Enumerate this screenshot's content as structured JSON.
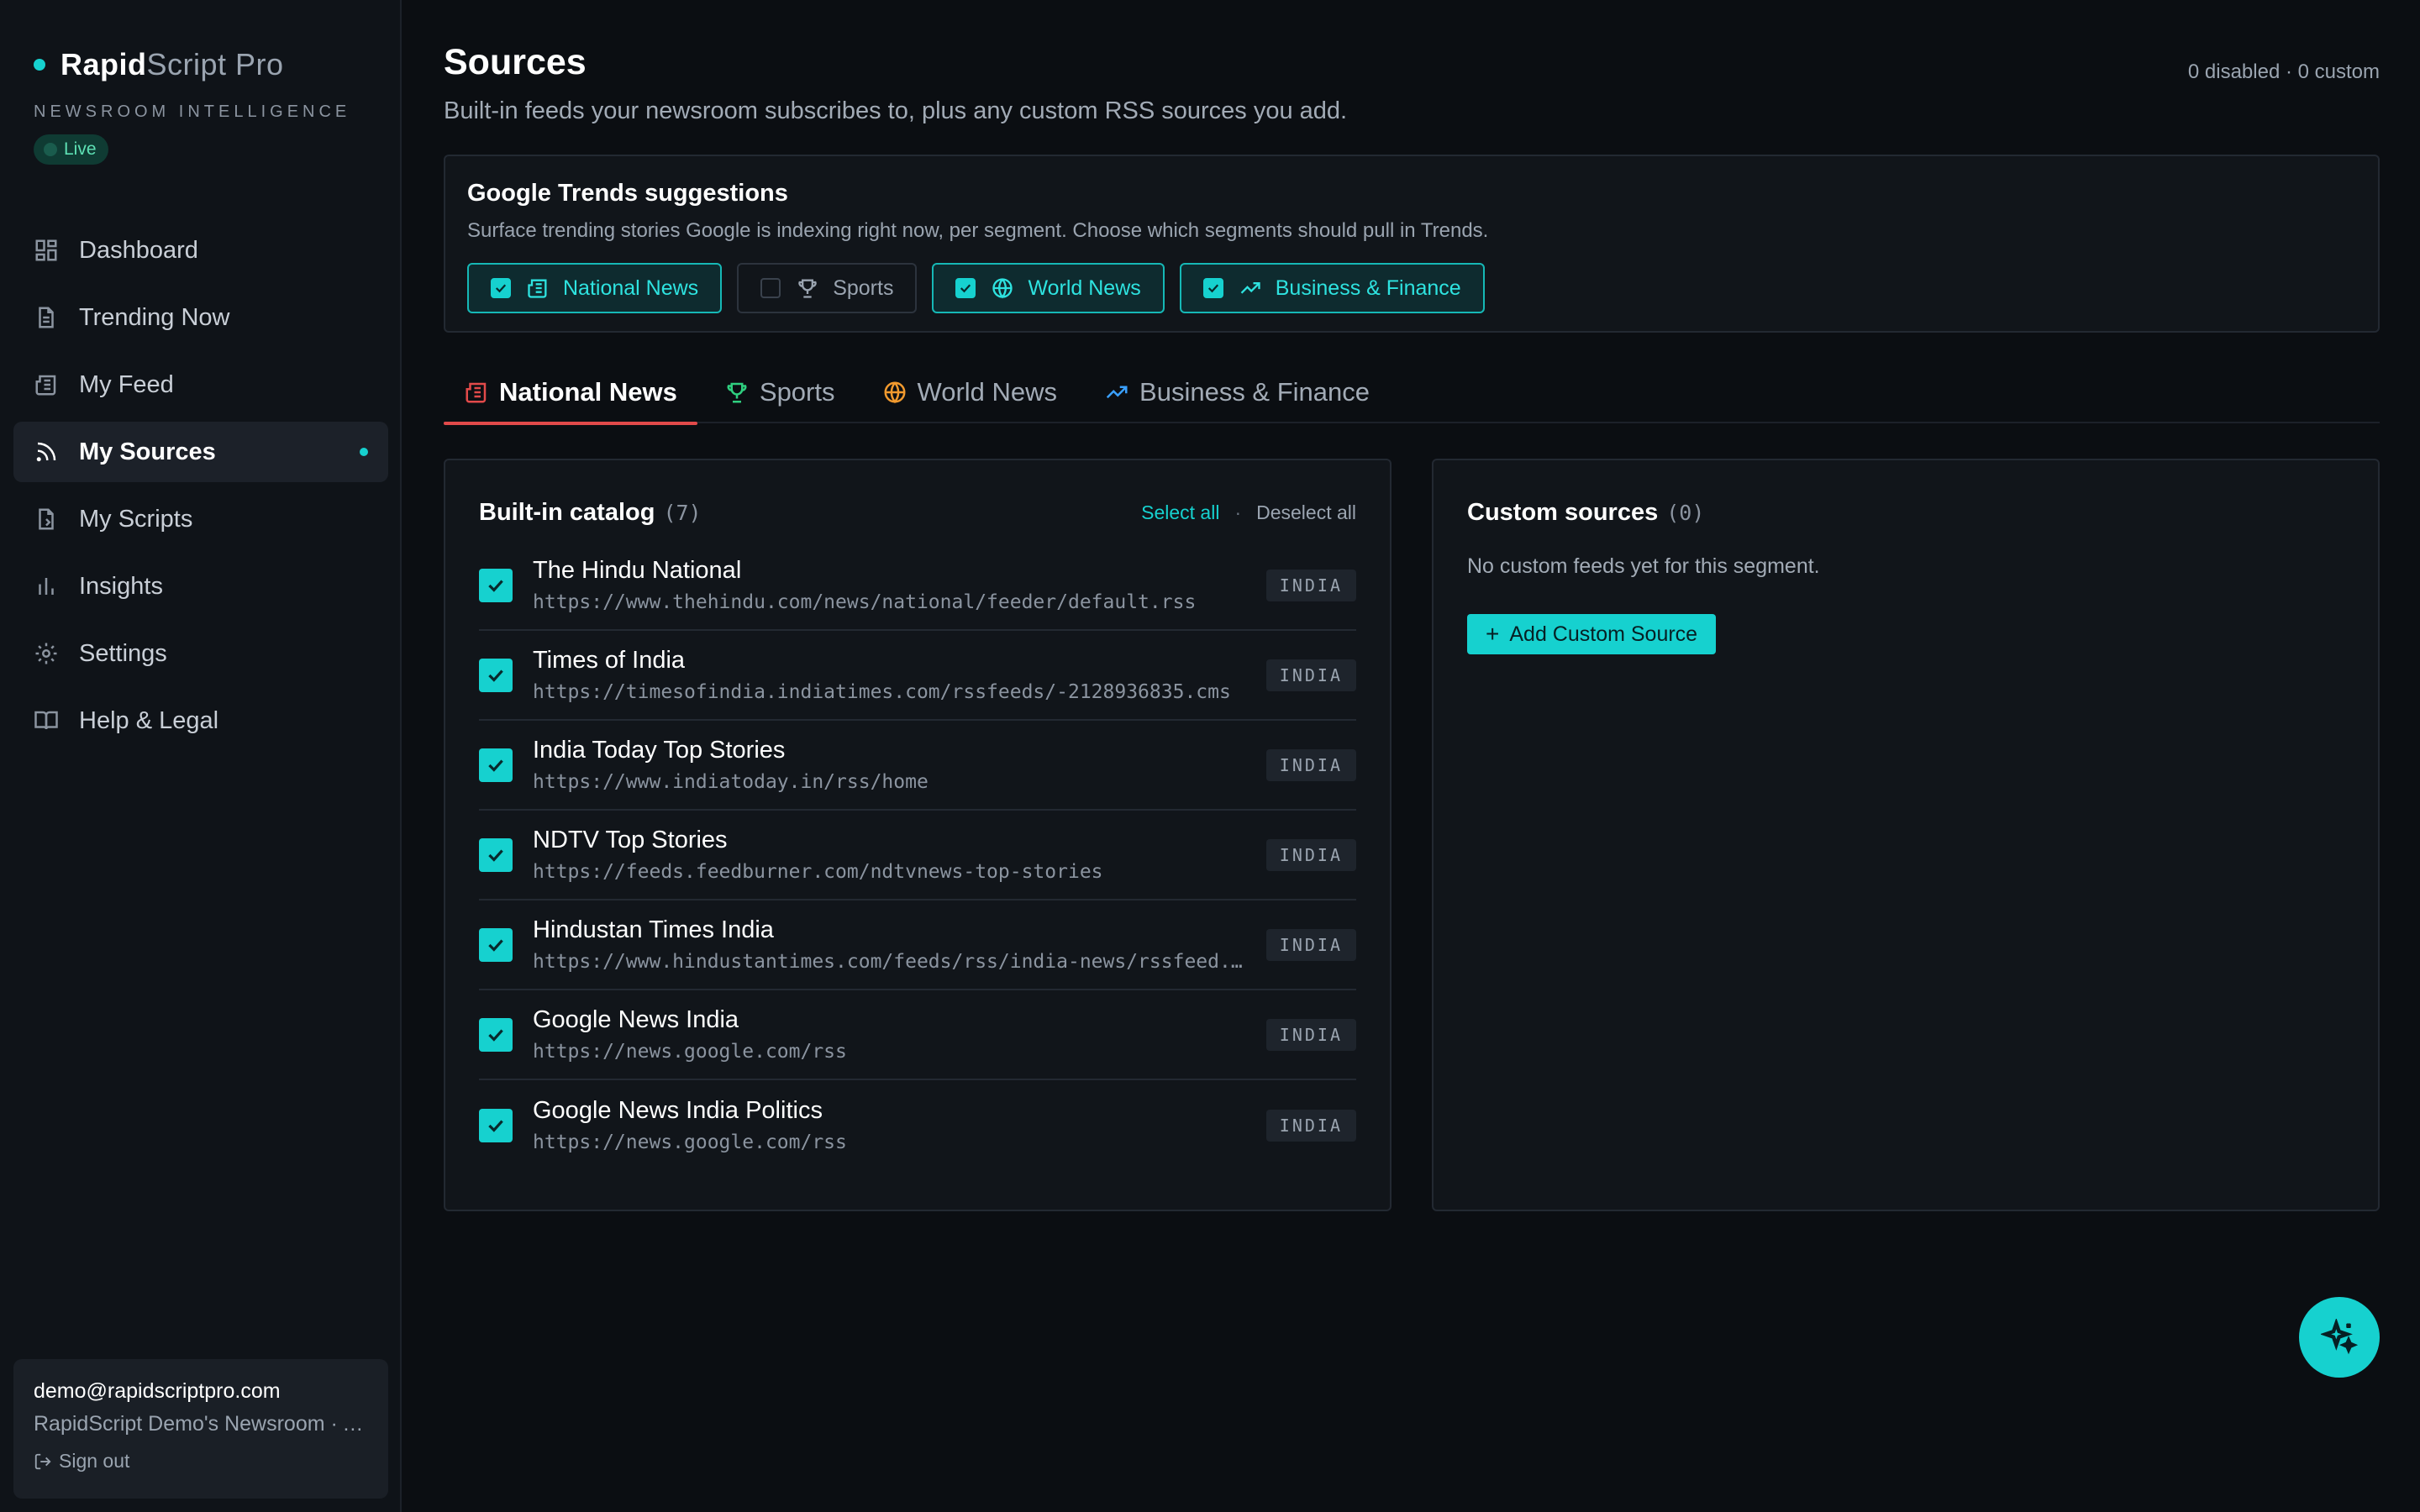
{
  "brand": {
    "name_bold": "Rapid",
    "name_light": "Script Pro",
    "tagline": "NEWSROOM INTELLIGENCE",
    "live": "Live"
  },
  "nav": [
    {
      "label": "Dashboard",
      "icon": "dashboard-icon",
      "active": false
    },
    {
      "label": "Trending Now",
      "icon": "document-icon",
      "active": false
    },
    {
      "label": "My Feed",
      "icon": "newspaper-icon",
      "active": false
    },
    {
      "label": "My Sources",
      "icon": "rss-icon",
      "active": true
    },
    {
      "label": "My Scripts",
      "icon": "script-icon",
      "active": false
    },
    {
      "label": "Insights",
      "icon": "bar-chart-icon",
      "active": false
    },
    {
      "label": "Settings",
      "icon": "gear-icon",
      "active": false
    },
    {
      "label": "Help & Legal",
      "icon": "book-icon",
      "active": false
    }
  ],
  "account": {
    "email": "demo@rapidscriptpro.com",
    "org": "RapidScript Demo's Newsroom · Admin",
    "signout": "Sign out"
  },
  "page": {
    "title": "Sources",
    "subtitle": "Built-in feeds your newsroom subscribes to, plus any custom RSS sources you add.",
    "meta": "0 disabled · 0 custom"
  },
  "trends": {
    "title": "Google Trends suggestions",
    "description": "Surface trending stories Google is indexing right now, per segment. Choose which segments should pull in Trends.",
    "chips": [
      {
        "label": "National News",
        "checked": true,
        "icon": "newspaper-icon"
      },
      {
        "label": "Sports",
        "checked": false,
        "icon": "trophy-icon"
      },
      {
        "label": "World News",
        "checked": true,
        "icon": "globe-icon"
      },
      {
        "label": "Business & Finance",
        "checked": true,
        "icon": "trending-up-icon"
      }
    ]
  },
  "tabs": [
    {
      "label": "National News",
      "icon": "newspaper-icon",
      "color": "#e24a4a",
      "active": true
    },
    {
      "label": "Sports",
      "icon": "trophy-icon",
      "color": "#2fcf7f",
      "active": false
    },
    {
      "label": "World News",
      "icon": "globe-icon",
      "color": "#f29a2e",
      "active": false
    },
    {
      "label": "Business & Finance",
      "icon": "trending-up-icon",
      "color": "#3aa0ff",
      "active": false
    }
  ],
  "catalog": {
    "title": "Built-in catalog",
    "count": "(7)",
    "select_all": "Select all",
    "separator": "·",
    "deselect_all": "Deselect all",
    "items": [
      {
        "name": "The Hindu National",
        "url": "https://www.thehindu.com/news/national/feeder/default.rss",
        "tag": "INDIA"
      },
      {
        "name": "Times of India",
        "url": "https://timesofindia.indiatimes.com/rssfeeds/-2128936835.cms",
        "tag": "INDIA"
      },
      {
        "name": "India Today Top Stories",
        "url": "https://www.indiatoday.in/rss/home",
        "tag": "INDIA"
      },
      {
        "name": "NDTV Top Stories",
        "url": "https://feeds.feedburner.com/ndtvnews-top-stories",
        "tag": "INDIA"
      },
      {
        "name": "Hindustan Times India",
        "url": "https://www.hindustantimes.com/feeds/rss/india-news/rssfeed.xml",
        "tag": "INDIA"
      },
      {
        "name": "Google News India",
        "url": "https://news.google.com/rss",
        "tag": "INDIA"
      },
      {
        "name": "Google News India Politics",
        "url": "https://news.google.com/rss",
        "tag": "INDIA"
      }
    ]
  },
  "custom": {
    "title": "Custom sources",
    "count": "(0)",
    "empty": "No custom feeds yet for this segment.",
    "add_plus": "+",
    "add_label": "Add Custom Source"
  },
  "colors": {
    "accent": "#16d1cf",
    "tab_underline": "#e24a4a",
    "background": "#0b0e12"
  }
}
